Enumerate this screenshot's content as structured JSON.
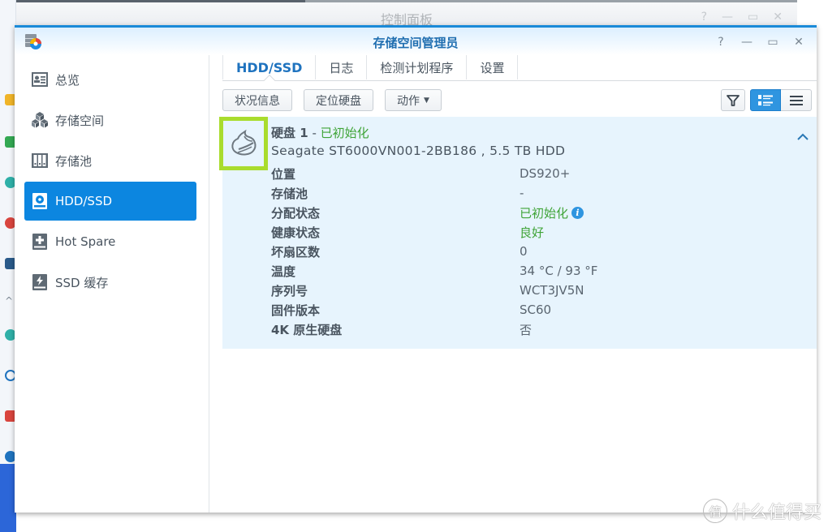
{
  "background_window": {
    "title": "控制面板",
    "controls": [
      "?",
      "—",
      "▭",
      "✕"
    ]
  },
  "window": {
    "title": "存储空间管理员",
    "controls": {
      "help": "?",
      "minimize": "—",
      "maximize": "▭",
      "close": "✕"
    }
  },
  "sidebar": {
    "items": [
      {
        "label": "总览",
        "icon": "overview-icon",
        "active": false
      },
      {
        "label": "存储空间",
        "icon": "storage-space-icon",
        "active": false
      },
      {
        "label": "存储池",
        "icon": "storage-pool-icon",
        "active": false
      },
      {
        "label": "HDD/SSD",
        "icon": "hdd-icon",
        "active": true
      },
      {
        "label": "Hot Spare",
        "icon": "hot-spare-icon",
        "active": false
      },
      {
        "label": "SSD 缓存",
        "icon": "ssd-cache-icon",
        "active": false
      }
    ]
  },
  "tabs": [
    {
      "label": "HDD/SSD",
      "active": true
    },
    {
      "label": "日志",
      "active": false
    },
    {
      "label": "检测计划程序",
      "active": false
    },
    {
      "label": "设置",
      "active": false
    }
  ],
  "toolbar": {
    "status_info": "状况信息",
    "locate_disk": "定位硬盘",
    "action": "动作",
    "filter_icon": "filter-icon",
    "view_detail_icon": "list-detail-icon",
    "view_list_icon": "list-icon"
  },
  "disk": {
    "name": "硬盘 1",
    "separator": " - ",
    "status": "已初始化",
    "model": "Seagate ST6000VN001-2BB186 , 5.5 TB HDD",
    "details": [
      {
        "label": "位置",
        "value": "DS920+",
        "green": false
      },
      {
        "label": "存储池",
        "value": "-",
        "green": false
      },
      {
        "label": "分配状态",
        "value": "已初始化",
        "green": true,
        "info": true
      },
      {
        "label": "健康状态",
        "value": "良好",
        "green": true
      },
      {
        "label": "坏扇区数",
        "value": "0",
        "green": false
      },
      {
        "label": "温度",
        "value": "34 °C / 93 °F",
        "green": false
      },
      {
        "label": "序列号",
        "value": "WCT3JV5N",
        "green": false
      },
      {
        "label": "固件版本",
        "value": "SC60",
        "green": false
      },
      {
        "label": "4K 原生硬盘",
        "value": "否",
        "green": false
      }
    ]
  },
  "colors": {
    "accent": "#0c86e0",
    "status_green": "#3fa437",
    "highlight_box": "#a9dc2d",
    "card_bg": "#e7f4fd"
  },
  "watermark": {
    "badge": "值",
    "text": "什么值得买"
  }
}
